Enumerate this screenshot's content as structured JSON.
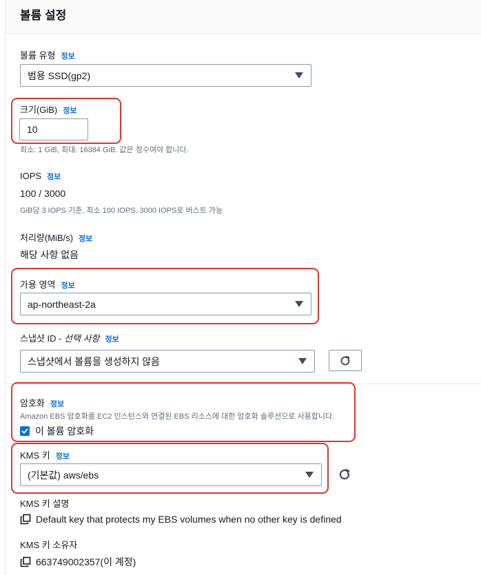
{
  "section": {
    "title": "볼륨 설정"
  },
  "info_label": "정보",
  "volume_type": {
    "label": "볼륨 유형",
    "value": "범용 SSD(gp2)"
  },
  "size": {
    "label": "크기(GiB)",
    "value": "10",
    "hint": "최소: 1 GiB, 최대: 16384 GiB. 값은 정수여야 합니다."
  },
  "iops": {
    "label": "IOPS",
    "value": "100 / 3000",
    "hint": "GiB당 3 IOPS 기준, 최소 100 IOPS, 3000 IOPS로 버스트 가능"
  },
  "throughput": {
    "label": "처리량(MiB/s)",
    "value": "해당 사항 없음"
  },
  "availability_zone": {
    "label": "가용 영역",
    "value": "ap-northeast-2a"
  },
  "snapshot": {
    "label_main": "스냅샷 ID - ",
    "label_optional": "선택 사항",
    "value": "스냅샷에서 볼륨을 생성하지 않음"
  },
  "encryption": {
    "label": "암호화",
    "description": "Amazon EBS 암호화를 EC2 인스턴스와 연결된 EBS 리소스에 대한 암호화 솔루션으로 사용합니다.",
    "checkbox_label": "이 볼륨 암호화",
    "checked": true
  },
  "kms_key": {
    "label": "KMS 키",
    "value": "(기본값) aws/ebs"
  },
  "kms_description": {
    "label": "KMS 키 설명",
    "value": "Default key that protects my EBS volumes when no other key is defined"
  },
  "kms_owner": {
    "label": "KMS 키 소유자",
    "value": "663749002357(이 계정)"
  },
  "colors": {
    "highlight": "#e4322b",
    "link": "#0972d3",
    "checkbox": "#0972d3"
  }
}
